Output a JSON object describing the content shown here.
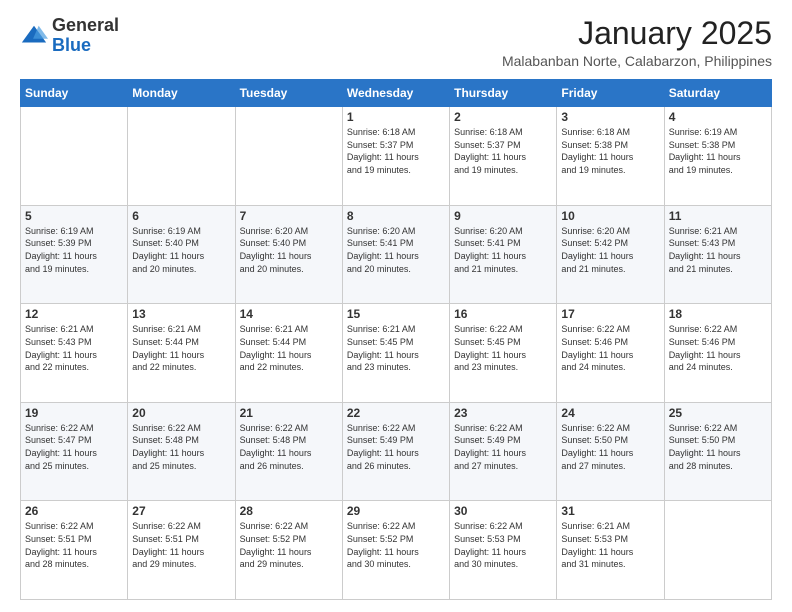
{
  "logo": {
    "general": "General",
    "blue": "Blue"
  },
  "header": {
    "month_title": "January 2025",
    "subtitle": "Malabanban Norte, Calabarzon, Philippines"
  },
  "days_of_week": [
    "Sunday",
    "Monday",
    "Tuesday",
    "Wednesday",
    "Thursday",
    "Friday",
    "Saturday"
  ],
  "weeks": [
    [
      {
        "day": "",
        "info": ""
      },
      {
        "day": "",
        "info": ""
      },
      {
        "day": "",
        "info": ""
      },
      {
        "day": "1",
        "info": "Sunrise: 6:18 AM\nSunset: 5:37 PM\nDaylight: 11 hours\nand 19 minutes."
      },
      {
        "day": "2",
        "info": "Sunrise: 6:18 AM\nSunset: 5:37 PM\nDaylight: 11 hours\nand 19 minutes."
      },
      {
        "day": "3",
        "info": "Sunrise: 6:18 AM\nSunset: 5:38 PM\nDaylight: 11 hours\nand 19 minutes."
      },
      {
        "day": "4",
        "info": "Sunrise: 6:19 AM\nSunset: 5:38 PM\nDaylight: 11 hours\nand 19 minutes."
      }
    ],
    [
      {
        "day": "5",
        "info": "Sunrise: 6:19 AM\nSunset: 5:39 PM\nDaylight: 11 hours\nand 19 minutes."
      },
      {
        "day": "6",
        "info": "Sunrise: 6:19 AM\nSunset: 5:40 PM\nDaylight: 11 hours\nand 20 minutes."
      },
      {
        "day": "7",
        "info": "Sunrise: 6:20 AM\nSunset: 5:40 PM\nDaylight: 11 hours\nand 20 minutes."
      },
      {
        "day": "8",
        "info": "Sunrise: 6:20 AM\nSunset: 5:41 PM\nDaylight: 11 hours\nand 20 minutes."
      },
      {
        "day": "9",
        "info": "Sunrise: 6:20 AM\nSunset: 5:41 PM\nDaylight: 11 hours\nand 21 minutes."
      },
      {
        "day": "10",
        "info": "Sunrise: 6:20 AM\nSunset: 5:42 PM\nDaylight: 11 hours\nand 21 minutes."
      },
      {
        "day": "11",
        "info": "Sunrise: 6:21 AM\nSunset: 5:43 PM\nDaylight: 11 hours\nand 21 minutes."
      }
    ],
    [
      {
        "day": "12",
        "info": "Sunrise: 6:21 AM\nSunset: 5:43 PM\nDaylight: 11 hours\nand 22 minutes."
      },
      {
        "day": "13",
        "info": "Sunrise: 6:21 AM\nSunset: 5:44 PM\nDaylight: 11 hours\nand 22 minutes."
      },
      {
        "day": "14",
        "info": "Sunrise: 6:21 AM\nSunset: 5:44 PM\nDaylight: 11 hours\nand 22 minutes."
      },
      {
        "day": "15",
        "info": "Sunrise: 6:21 AM\nSunset: 5:45 PM\nDaylight: 11 hours\nand 23 minutes."
      },
      {
        "day": "16",
        "info": "Sunrise: 6:22 AM\nSunset: 5:45 PM\nDaylight: 11 hours\nand 23 minutes."
      },
      {
        "day": "17",
        "info": "Sunrise: 6:22 AM\nSunset: 5:46 PM\nDaylight: 11 hours\nand 24 minutes."
      },
      {
        "day": "18",
        "info": "Sunrise: 6:22 AM\nSunset: 5:46 PM\nDaylight: 11 hours\nand 24 minutes."
      }
    ],
    [
      {
        "day": "19",
        "info": "Sunrise: 6:22 AM\nSunset: 5:47 PM\nDaylight: 11 hours\nand 25 minutes."
      },
      {
        "day": "20",
        "info": "Sunrise: 6:22 AM\nSunset: 5:48 PM\nDaylight: 11 hours\nand 25 minutes."
      },
      {
        "day": "21",
        "info": "Sunrise: 6:22 AM\nSunset: 5:48 PM\nDaylight: 11 hours\nand 26 minutes."
      },
      {
        "day": "22",
        "info": "Sunrise: 6:22 AM\nSunset: 5:49 PM\nDaylight: 11 hours\nand 26 minutes."
      },
      {
        "day": "23",
        "info": "Sunrise: 6:22 AM\nSunset: 5:49 PM\nDaylight: 11 hours\nand 27 minutes."
      },
      {
        "day": "24",
        "info": "Sunrise: 6:22 AM\nSunset: 5:50 PM\nDaylight: 11 hours\nand 27 minutes."
      },
      {
        "day": "25",
        "info": "Sunrise: 6:22 AM\nSunset: 5:50 PM\nDaylight: 11 hours\nand 28 minutes."
      }
    ],
    [
      {
        "day": "26",
        "info": "Sunrise: 6:22 AM\nSunset: 5:51 PM\nDaylight: 11 hours\nand 28 minutes."
      },
      {
        "day": "27",
        "info": "Sunrise: 6:22 AM\nSunset: 5:51 PM\nDaylight: 11 hours\nand 29 minutes."
      },
      {
        "day": "28",
        "info": "Sunrise: 6:22 AM\nSunset: 5:52 PM\nDaylight: 11 hours\nand 29 minutes."
      },
      {
        "day": "29",
        "info": "Sunrise: 6:22 AM\nSunset: 5:52 PM\nDaylight: 11 hours\nand 30 minutes."
      },
      {
        "day": "30",
        "info": "Sunrise: 6:22 AM\nSunset: 5:53 PM\nDaylight: 11 hours\nand 30 minutes."
      },
      {
        "day": "31",
        "info": "Sunrise: 6:21 AM\nSunset: 5:53 PM\nDaylight: 11 hours\nand 31 minutes."
      },
      {
        "day": "",
        "info": ""
      }
    ]
  ]
}
